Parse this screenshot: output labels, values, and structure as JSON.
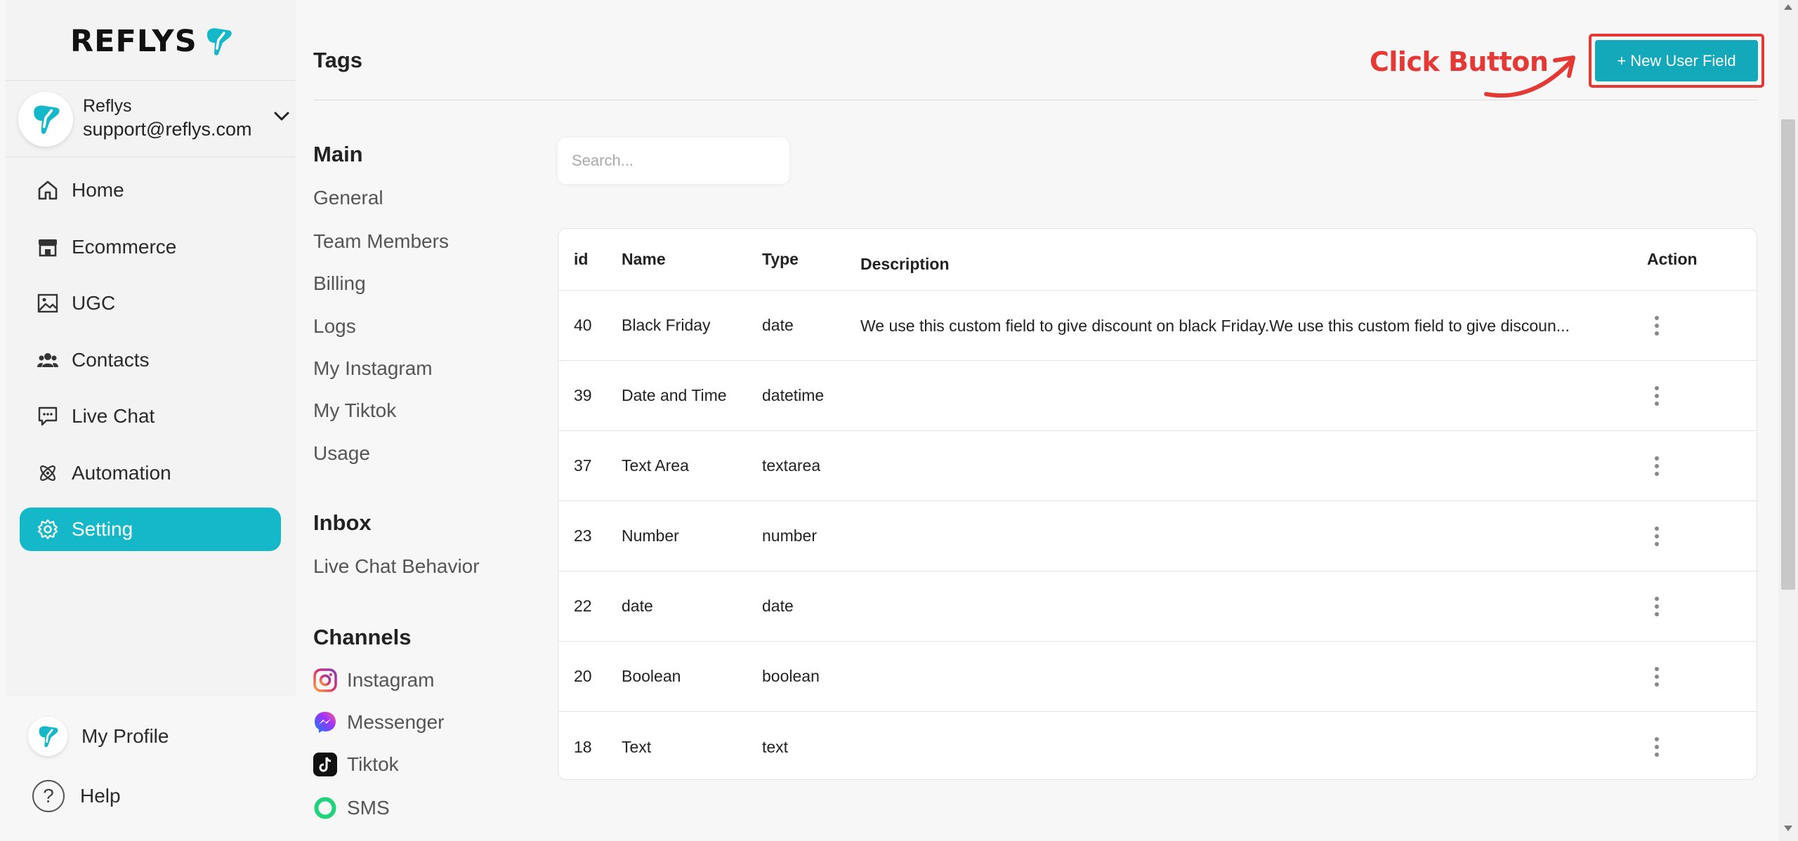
{
  "brand": {
    "name": "REFLYS",
    "accent": "#14b8c9"
  },
  "account": {
    "name": "Reflys",
    "email": "support@reflys.com"
  },
  "nav": [
    {
      "label": "Home",
      "icon": "home-icon",
      "active": false
    },
    {
      "label": "Ecommerce",
      "icon": "store-icon",
      "active": false
    },
    {
      "label": "UGC",
      "icon": "image-icon",
      "active": false
    },
    {
      "label": "Contacts",
      "icon": "users-icon",
      "active": false
    },
    {
      "label": "Live Chat",
      "icon": "chat-icon",
      "active": false
    },
    {
      "label": "Automation",
      "icon": "atom-icon",
      "active": false
    },
    {
      "label": "Setting",
      "icon": "gear-icon",
      "active": true
    }
  ],
  "bottom_nav": {
    "profile": "My Profile",
    "help": "Help"
  },
  "page": {
    "title": "Tags"
  },
  "annotation": {
    "text": "Click Button",
    "color": "#e53935"
  },
  "new_field_button": "+ New User Field",
  "settings_menu": {
    "main_title": "Main",
    "main_items": [
      "General",
      "Team Members",
      "Billing",
      "Logs",
      "My Instagram",
      "My Tiktok",
      "Usage"
    ],
    "inbox_title": "Inbox",
    "inbox_items": [
      "Live Chat Behavior"
    ],
    "channels_title": "Channels",
    "channels_items": [
      {
        "label": "Instagram",
        "icon": "instagram-icon"
      },
      {
        "label": "Messenger",
        "icon": "messenger-icon"
      },
      {
        "label": "Tiktok",
        "icon": "tiktok-icon"
      },
      {
        "label": "SMS",
        "icon": "sms-icon"
      }
    ]
  },
  "search": {
    "placeholder": "Search...",
    "value": ""
  },
  "table": {
    "columns": {
      "id": "id",
      "name": "Name",
      "type": "Type",
      "description": "Description",
      "action": "Action"
    },
    "rows": [
      {
        "id": "40",
        "name": "Black Friday",
        "type": "date",
        "description": "We use this custom field to give discount on black Friday.We use this custom field to give discoun..."
      },
      {
        "id": "39",
        "name": "Date and Time",
        "type": "datetime",
        "description": ""
      },
      {
        "id": "37",
        "name": "Text Area",
        "type": "textarea",
        "description": ""
      },
      {
        "id": "23",
        "name": "Number",
        "type": "number",
        "description": ""
      },
      {
        "id": "22",
        "name": "date",
        "type": "date",
        "description": ""
      },
      {
        "id": "20",
        "name": "Boolean",
        "type": "boolean",
        "description": ""
      },
      {
        "id": "18",
        "name": "Text",
        "type": "text",
        "description": ""
      }
    ]
  }
}
